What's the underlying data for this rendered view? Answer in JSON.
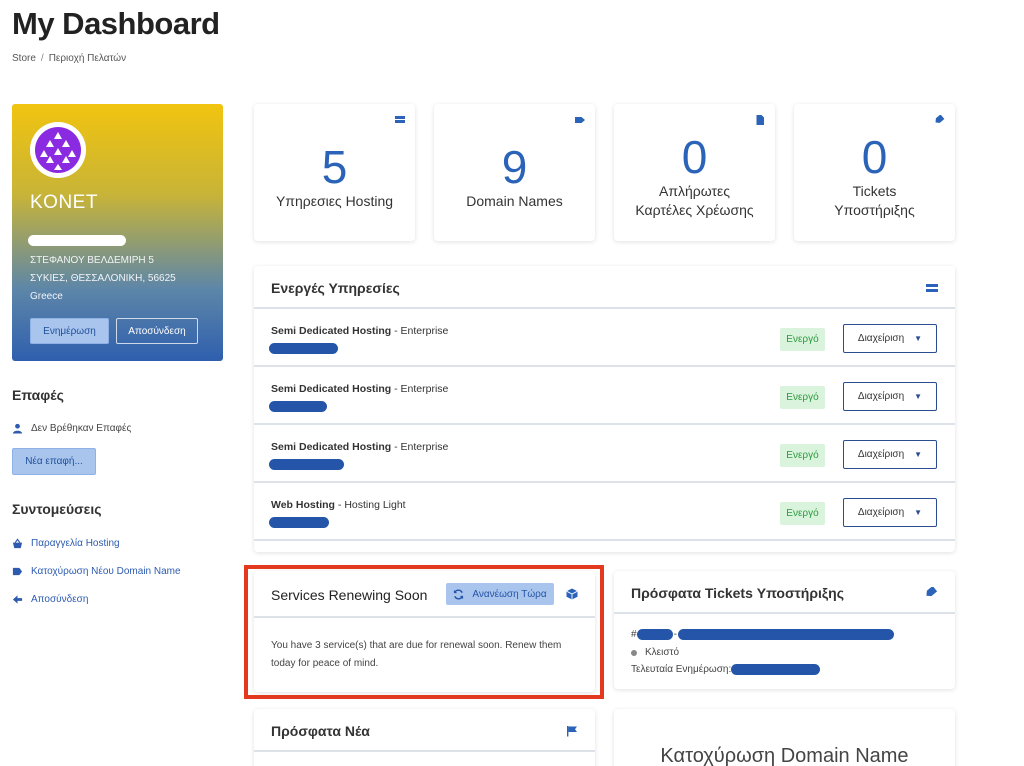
{
  "page": {
    "title": "My Dashboard",
    "breadcrumb": [
      "Store",
      "Περιοχή Πελατών"
    ]
  },
  "profile": {
    "company": "KONET",
    "address_line1": "ΣΤΕΦΑΝΟΥ ΒΕΛΔΕΜΙΡΗ 5",
    "address_line2": "ΣΥΚΙΕΣ, ΘΕΣΣΑΛΟΝΙΚΗ, 56625",
    "country": "Greece",
    "update_label": "Ενημέρωση",
    "logout_label": "Αποσύνδεση"
  },
  "contacts": {
    "heading": "Επαφές",
    "empty_text": "Δεν Βρέθηκαν Επαφές",
    "new_contact_label": "Νέα επαφή..."
  },
  "shortcuts": {
    "heading": "Συντομεύσεις",
    "items": [
      {
        "label": "Παραγγελία Hosting",
        "icon": "basket-icon"
      },
      {
        "label": "Κατοχύρωση Νέου Domain Name",
        "icon": "tag-icon"
      },
      {
        "label": "Αποσύνδεση",
        "icon": "arrow-left-icon"
      }
    ]
  },
  "stats": [
    {
      "number": "5",
      "label": "Υπηρεσιες Hosting",
      "icon": "server-icon"
    },
    {
      "number": "9",
      "label": "Domain Names",
      "icon": "tag-icon"
    },
    {
      "number": "0",
      "label_line1": "Απλήρωτες",
      "label_line2": "Καρτέλες Χρέωσης",
      "icon": "document-icon"
    },
    {
      "number": "0",
      "label_line1": "Tickets",
      "label_line2": "Υποστήριξης",
      "icon": "ticket-icon"
    }
  ],
  "active_services": {
    "title": "Ενεργές Υπηρεσίες",
    "rows": [
      {
        "product": "Semi Dedicated Hosting",
        "plan": " - Enterprise",
        "status": "Ενεργό",
        "action": "Διαχείριση"
      },
      {
        "product": "Semi Dedicated Hosting",
        "plan": " - Enterprise",
        "status": "Ενεργό",
        "action": "Διαχείριση"
      },
      {
        "product": "Semi Dedicated Hosting",
        "plan": " - Enterprise",
        "status": "Ενεργό",
        "action": "Διαχείριση"
      },
      {
        "product": "Web Hosting",
        "plan": " - Hosting Light",
        "status": "Ενεργό",
        "action": "Διαχείριση"
      }
    ]
  },
  "renewing": {
    "title": "Services Renewing Soon",
    "renew_label": "Ανανέωση Τώρα",
    "body": "You have 3 service(s) that are due for renewal soon. Renew them today for peace of mind."
  },
  "tickets": {
    "title": "Πρόσφατα Tickets Υποστήριξης",
    "hash": "#",
    "status": "Κλειστό",
    "last_update_label": "Τελευταία Ενημέρωση:"
  },
  "news": {
    "title": "Πρόσφατα Νέα"
  },
  "domain_register": {
    "title": "Κατοχύρωση Domain Name"
  },
  "colors": {
    "accent": "#2a63b8",
    "active_badge_bg": "#d9f3dc",
    "highlight": "#e33a1f"
  }
}
